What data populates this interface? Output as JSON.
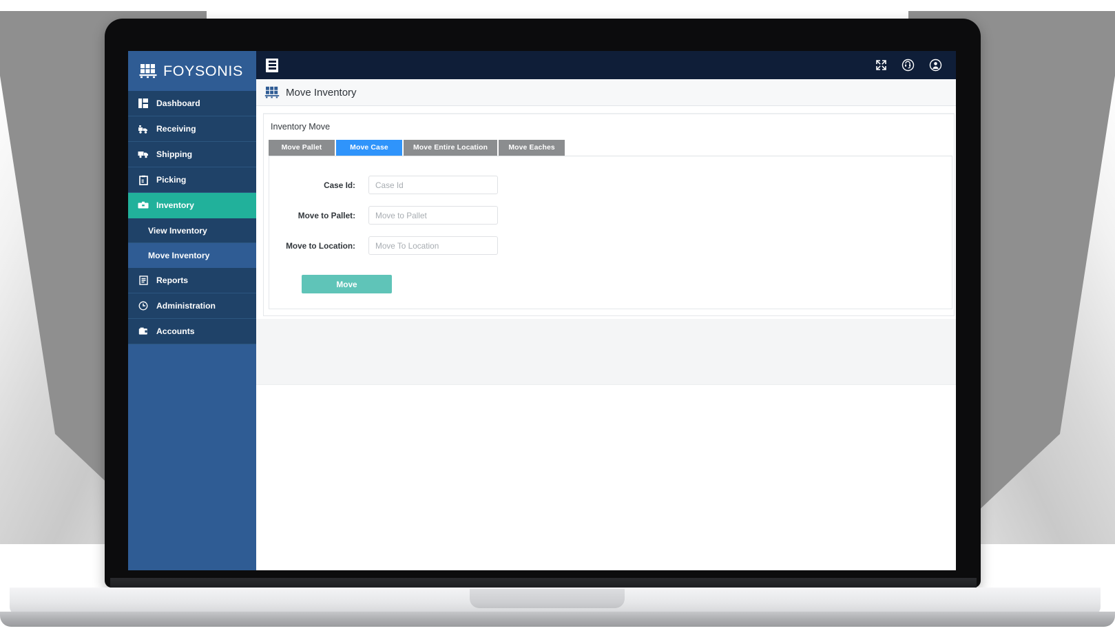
{
  "brand": {
    "name": "FOYSONIS",
    "logo_icon": "pallet-crate-icon"
  },
  "sidebar": {
    "items": [
      {
        "label": "Dashboard",
        "icon": "dashboard-grid-icon",
        "name": "dashboard"
      },
      {
        "label": "Receiving",
        "icon": "truck-loading-icon",
        "name": "receiving"
      },
      {
        "label": "Shipping",
        "icon": "delivery-truck-icon",
        "name": "shipping"
      },
      {
        "label": "Picking",
        "icon": "clipboard-pick-icon",
        "name": "picking"
      },
      {
        "label": "Inventory",
        "icon": "inventory-box-icon",
        "name": "inventory",
        "active": true
      },
      {
        "label": "Reports",
        "icon": "report-page-icon",
        "name": "reports"
      },
      {
        "label": "Administration",
        "icon": "clock-gear-icon",
        "name": "administration"
      },
      {
        "label": "Accounts",
        "icon": "wallet-icon",
        "name": "accounts"
      }
    ],
    "sub_items": [
      {
        "label": "View Inventory",
        "name": "view-inventory",
        "current": false
      },
      {
        "label": "Move Inventory",
        "name": "move-inventory",
        "current": true
      }
    ]
  },
  "topbar": {
    "menu_toggle_icon": "hamburger-menu-icon",
    "fullscreen_icon": "expand-fullscreen-icon",
    "support_icon": "headset-support-icon",
    "user_icon": "user-account-icon"
  },
  "page": {
    "title": "Move Inventory",
    "title_icon": "pallet-crate-icon"
  },
  "panel": {
    "heading": "Inventory Move",
    "tabs": [
      {
        "label": "Move Pallet",
        "name": "tab-move-pallet",
        "active": false
      },
      {
        "label": "Move Case",
        "name": "tab-move-case",
        "active": true
      },
      {
        "label": "Move Entire Location",
        "name": "tab-move-entire-location",
        "active": false
      },
      {
        "label": "Move Eaches",
        "name": "tab-move-eaches",
        "active": false
      }
    ],
    "form": {
      "fields": [
        {
          "label": "Case Id:",
          "placeholder": "Case Id",
          "value": "",
          "name": "case-id"
        },
        {
          "label": "Move to Pallet:",
          "placeholder": "Move to Pallet",
          "value": "",
          "name": "move-to-pallet"
        },
        {
          "label": "Move to Location:",
          "placeholder": "Move To Location",
          "value": "",
          "name": "move-to-location"
        }
      ],
      "submit_label": "Move"
    }
  },
  "colors": {
    "sidebar_top": "#2f5c94",
    "sidebar_nav": "#1f4268",
    "accent_teal": "#21b19b",
    "topbar_navy": "#0f1e38",
    "tab_active_blue": "#2f94fb",
    "tab_inactive_grey": "#8b8d8f",
    "button_teal": "#5fc4b8"
  }
}
